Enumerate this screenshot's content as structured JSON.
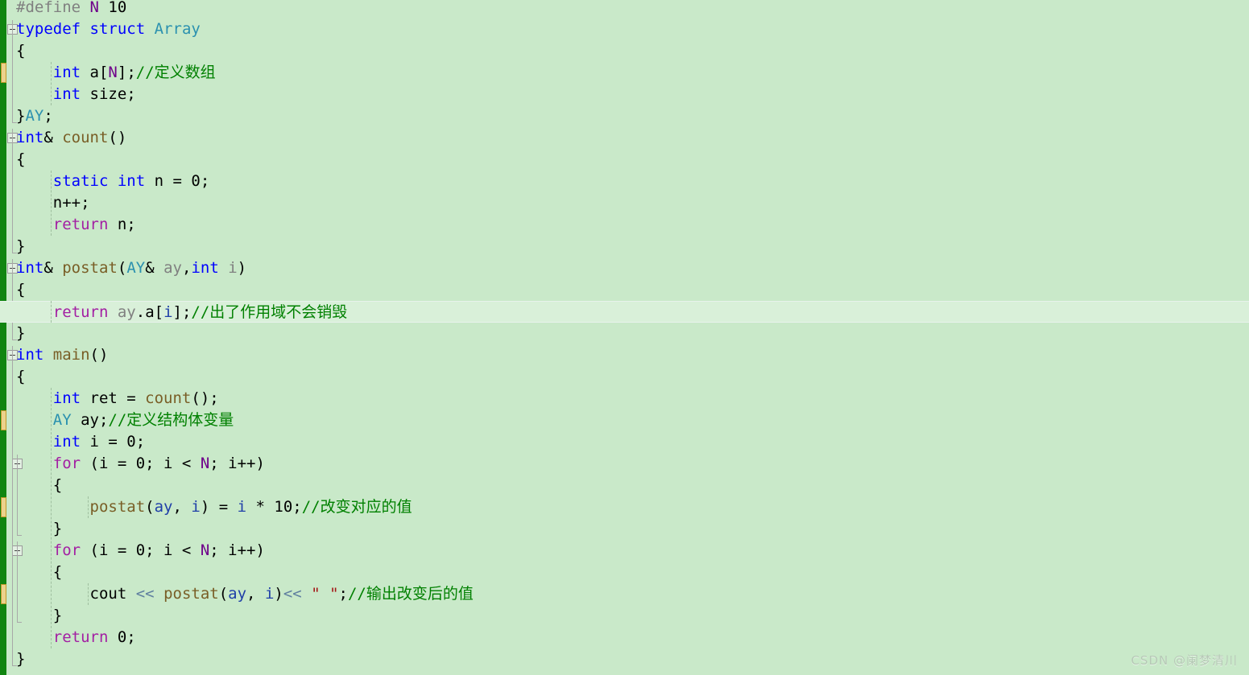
{
  "editor": {
    "background_color": "#c9e9c9",
    "current_line_color": "#d9f0d9",
    "change_bar_saved_color": "#108510",
    "change_bar_unsaved_color": "#ecd28c",
    "font_size_px": 19,
    "line_height_px": 27
  },
  "watermark": {
    "text": "CSDN @阑梦清川"
  },
  "code": {
    "language": "cpp",
    "lines": [
      {
        "n": 1,
        "indent": 0,
        "unsaved": false,
        "current": false,
        "fold": null,
        "tokens": [
          {
            "t": "#define ",
            "c": "pre"
          },
          {
            "t": "N",
            "c": "mac"
          },
          {
            "t": " ",
            "c": "pl"
          },
          {
            "t": "10",
            "c": "pl"
          }
        ]
      },
      {
        "n": 2,
        "indent": 0,
        "unsaved": false,
        "current": false,
        "fold": "open",
        "tokens": [
          {
            "t": "typedef",
            "c": "k"
          },
          {
            "t": " ",
            "c": "pl"
          },
          {
            "t": "struct",
            "c": "k"
          },
          {
            "t": " ",
            "c": "pl"
          },
          {
            "t": "Array",
            "c": "typ"
          }
        ]
      },
      {
        "n": 3,
        "indent": 0,
        "unsaved": false,
        "current": false,
        "fold": null,
        "tokens": [
          {
            "t": "{",
            "c": "pl"
          }
        ]
      },
      {
        "n": 4,
        "indent": 1,
        "unsaved": true,
        "current": false,
        "fold": null,
        "tokens": [
          {
            "t": "    ",
            "c": "pl"
          },
          {
            "t": "int",
            "c": "k"
          },
          {
            "t": " a[",
            "c": "pl"
          },
          {
            "t": "N",
            "c": "mac"
          },
          {
            "t": "];",
            "c": "pl"
          },
          {
            "t": "//定义数组",
            "c": "cmt"
          }
        ]
      },
      {
        "n": 5,
        "indent": 1,
        "unsaved": false,
        "current": false,
        "fold": null,
        "tokens": [
          {
            "t": "    ",
            "c": "pl"
          },
          {
            "t": "int",
            "c": "k"
          },
          {
            "t": " size;",
            "c": "pl"
          }
        ]
      },
      {
        "n": 6,
        "indent": 0,
        "unsaved": false,
        "current": false,
        "fold": null,
        "tokens": [
          {
            "t": "}",
            "c": "pl"
          },
          {
            "t": "AY",
            "c": "typ"
          },
          {
            "t": ";",
            "c": "pl"
          }
        ]
      },
      {
        "n": 7,
        "indent": 0,
        "unsaved": false,
        "current": false,
        "fold": "open",
        "tokens": [
          {
            "t": "int",
            "c": "k"
          },
          {
            "t": "& ",
            "c": "pl"
          },
          {
            "t": "count",
            "c": "fn"
          },
          {
            "t": "()",
            "c": "pl"
          }
        ]
      },
      {
        "n": 8,
        "indent": 0,
        "unsaved": false,
        "current": false,
        "fold": null,
        "tokens": [
          {
            "t": "{",
            "c": "pl"
          }
        ]
      },
      {
        "n": 9,
        "indent": 1,
        "unsaved": false,
        "current": false,
        "fold": null,
        "tokens": [
          {
            "t": "    ",
            "c": "pl"
          },
          {
            "t": "static",
            "c": "k"
          },
          {
            "t": " ",
            "c": "pl"
          },
          {
            "t": "int",
            "c": "k"
          },
          {
            "t": " n = 0;",
            "c": "pl"
          }
        ]
      },
      {
        "n": 10,
        "indent": 1,
        "unsaved": false,
        "current": false,
        "fold": null,
        "tokens": [
          {
            "t": "    n++;",
            "c": "pl"
          }
        ]
      },
      {
        "n": 11,
        "indent": 1,
        "unsaved": false,
        "current": false,
        "fold": null,
        "tokens": [
          {
            "t": "    ",
            "c": "pl"
          },
          {
            "t": "return",
            "c": "ctl"
          },
          {
            "t": " n;",
            "c": "pl"
          }
        ]
      },
      {
        "n": 12,
        "indent": 0,
        "unsaved": false,
        "current": false,
        "fold": null,
        "tokens": [
          {
            "t": "}",
            "c": "pl"
          }
        ]
      },
      {
        "n": 13,
        "indent": 0,
        "unsaved": false,
        "current": false,
        "fold": "open",
        "tokens": [
          {
            "t": "int",
            "c": "k"
          },
          {
            "t": "& ",
            "c": "pl"
          },
          {
            "t": "postat",
            "c": "fn"
          },
          {
            "t": "(",
            "c": "pl"
          },
          {
            "t": "AY",
            "c": "typ"
          },
          {
            "t": "& ",
            "c": "pl"
          },
          {
            "t": "ay",
            "c": "par"
          },
          {
            "t": ",",
            "c": "pl"
          },
          {
            "t": "int",
            "c": "k"
          },
          {
            "t": " ",
            "c": "pl"
          },
          {
            "t": "i",
            "c": "par"
          },
          {
            "t": ")",
            "c": "pl"
          }
        ]
      },
      {
        "n": 14,
        "indent": 0,
        "unsaved": false,
        "current": false,
        "fold": null,
        "tokens": [
          {
            "t": "{",
            "c": "pl"
          }
        ]
      },
      {
        "n": 15,
        "indent": 1,
        "unsaved": true,
        "current": true,
        "fold": null,
        "tokens": [
          {
            "t": "    ",
            "c": "pl"
          },
          {
            "t": "return",
            "c": "ctl"
          },
          {
            "t": " ",
            "c": "pl"
          },
          {
            "t": "ay",
            "c": "par"
          },
          {
            "t": ".a[",
            "c": "pl"
          },
          {
            "t": "i",
            "c": "var"
          },
          {
            "t": "];",
            "c": "pl"
          },
          {
            "t": "//出了作用域不会销毁",
            "c": "cmt"
          }
        ]
      },
      {
        "n": 16,
        "indent": 0,
        "unsaved": false,
        "current": false,
        "fold": null,
        "tokens": [
          {
            "t": "}",
            "c": "pl"
          }
        ]
      },
      {
        "n": 17,
        "indent": 0,
        "unsaved": false,
        "current": false,
        "fold": "open",
        "tokens": [
          {
            "t": "int",
            "c": "k"
          },
          {
            "t": " ",
            "c": "pl"
          },
          {
            "t": "main",
            "c": "fn"
          },
          {
            "t": "()",
            "c": "pl"
          }
        ]
      },
      {
        "n": 18,
        "indent": 0,
        "unsaved": false,
        "current": false,
        "fold": null,
        "tokens": [
          {
            "t": "{",
            "c": "pl"
          }
        ]
      },
      {
        "n": 19,
        "indent": 1,
        "unsaved": false,
        "current": false,
        "fold": null,
        "tokens": [
          {
            "t": "    ",
            "c": "pl"
          },
          {
            "t": "int",
            "c": "k"
          },
          {
            "t": " ret = ",
            "c": "pl"
          },
          {
            "t": "count",
            "c": "fn"
          },
          {
            "t": "();",
            "c": "pl"
          }
        ]
      },
      {
        "n": 20,
        "indent": 1,
        "unsaved": true,
        "current": false,
        "fold": null,
        "tokens": [
          {
            "t": "    ",
            "c": "pl"
          },
          {
            "t": "AY",
            "c": "typ"
          },
          {
            "t": " ay;",
            "c": "pl"
          },
          {
            "t": "//定义结构体变量",
            "c": "cmt"
          }
        ]
      },
      {
        "n": 21,
        "indent": 1,
        "unsaved": false,
        "current": false,
        "fold": null,
        "tokens": [
          {
            "t": "    ",
            "c": "pl"
          },
          {
            "t": "int",
            "c": "k"
          },
          {
            "t": " i = 0;",
            "c": "pl"
          }
        ]
      },
      {
        "n": 22,
        "indent": 1,
        "unsaved": false,
        "current": false,
        "fold": "open",
        "tokens": [
          {
            "t": "    ",
            "c": "pl"
          },
          {
            "t": "for",
            "c": "ctl"
          },
          {
            "t": " (i = 0; i < ",
            "c": "pl"
          },
          {
            "t": "N",
            "c": "mac"
          },
          {
            "t": "; i++)",
            "c": "pl"
          }
        ]
      },
      {
        "n": 23,
        "indent": 1,
        "unsaved": false,
        "current": false,
        "fold": null,
        "tokens": [
          {
            "t": "    {",
            "c": "pl"
          }
        ]
      },
      {
        "n": 24,
        "indent": 2,
        "unsaved": true,
        "current": false,
        "fold": null,
        "tokens": [
          {
            "t": "        ",
            "c": "pl"
          },
          {
            "t": "postat",
            "c": "fn"
          },
          {
            "t": "(",
            "c": "pl"
          },
          {
            "t": "ay",
            "c": "var"
          },
          {
            "t": ", ",
            "c": "pl"
          },
          {
            "t": "i",
            "c": "var"
          },
          {
            "t": ") = ",
            "c": "pl"
          },
          {
            "t": "i",
            "c": "var"
          },
          {
            "t": " * 10;",
            "c": "pl"
          },
          {
            "t": "//改变对应的值",
            "c": "cmt"
          }
        ]
      },
      {
        "n": 25,
        "indent": 1,
        "unsaved": false,
        "current": false,
        "fold": null,
        "tokens": [
          {
            "t": "    }",
            "c": "pl"
          }
        ]
      },
      {
        "n": 26,
        "indent": 1,
        "unsaved": false,
        "current": false,
        "fold": "open",
        "tokens": [
          {
            "t": "    ",
            "c": "pl"
          },
          {
            "t": "for",
            "c": "ctl"
          },
          {
            "t": " (i = 0; i < ",
            "c": "pl"
          },
          {
            "t": "N",
            "c": "mac"
          },
          {
            "t": "; i++)",
            "c": "pl"
          }
        ]
      },
      {
        "n": 27,
        "indent": 1,
        "unsaved": false,
        "current": false,
        "fold": null,
        "tokens": [
          {
            "t": "    {",
            "c": "pl"
          }
        ]
      },
      {
        "n": 28,
        "indent": 2,
        "unsaved": true,
        "current": false,
        "fold": null,
        "tokens": [
          {
            "t": "        cout ",
            "c": "pl"
          },
          {
            "t": "<<",
            "c": "op"
          },
          {
            "t": " ",
            "c": "pl"
          },
          {
            "t": "postat",
            "c": "fn"
          },
          {
            "t": "(",
            "c": "pl"
          },
          {
            "t": "ay",
            "c": "var"
          },
          {
            "t": ", ",
            "c": "pl"
          },
          {
            "t": "i",
            "c": "var"
          },
          {
            "t": ")",
            "c": "pl"
          },
          {
            "t": "<<",
            "c": "op"
          },
          {
            "t": " ",
            "c": "pl"
          },
          {
            "t": "\" \"",
            "c": "str"
          },
          {
            "t": ";",
            "c": "pl"
          },
          {
            "t": "//输出改变后的值",
            "c": "cmt"
          }
        ]
      },
      {
        "n": 29,
        "indent": 1,
        "unsaved": false,
        "current": false,
        "fold": null,
        "tokens": [
          {
            "t": "    }",
            "c": "pl"
          }
        ]
      },
      {
        "n": 30,
        "indent": 1,
        "unsaved": false,
        "current": false,
        "fold": null,
        "tokens": [
          {
            "t": "    ",
            "c": "pl"
          },
          {
            "t": "return",
            "c": "ctl"
          },
          {
            "t": " 0;",
            "c": "pl"
          }
        ]
      },
      {
        "n": 31,
        "indent": 0,
        "unsaved": false,
        "current": false,
        "fold": null,
        "tokens": [
          {
            "t": "}",
            "c": "pl"
          }
        ]
      }
    ]
  }
}
